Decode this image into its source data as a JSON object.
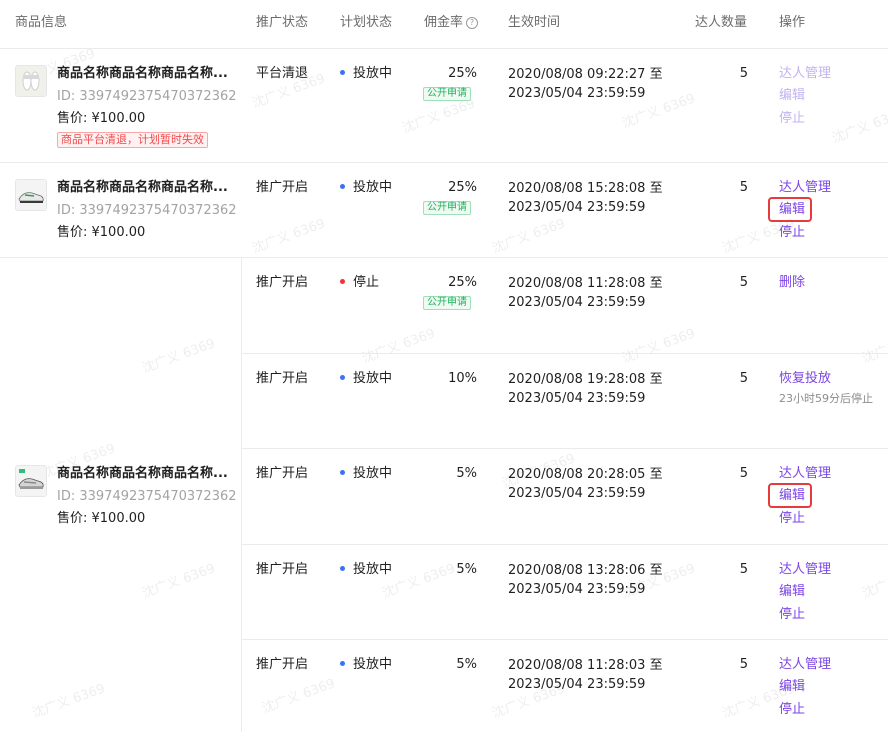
{
  "header": {
    "product_info": "商品信息",
    "promo_status": "推广状态",
    "plan_status": "计划状态",
    "commission_rate": "佣金率",
    "effective_time": "生效时间",
    "creator_count": "达人数量",
    "actions": "操作",
    "help_glyph": "?"
  },
  "products": [
    {
      "name": "商品名称商品名称商品名称...",
      "id": "ID: 3397492375470372362",
      "price": "售价: ¥100.00",
      "warning": "商品平台清退，计划暂时失效"
    },
    {
      "name": "商品名称商品名称商品名称...",
      "id": "ID: 3397492375470372362",
      "price": "售价: ¥100.00"
    },
    {
      "name": "商品名称商品名称商品名称...",
      "id": "ID: 3397492375470372362",
      "price": "售价: ¥100.00"
    }
  ],
  "rows": [
    {
      "promo": "平台清退",
      "plan": "投放中",
      "plan_color": "blue",
      "rate": "25%",
      "tag": "公开申请",
      "time1": "2020/08/08  09:22:27 至",
      "time2": "2023/05/04  23:59:59",
      "count": "5",
      "actions": [
        "达人管理",
        "编辑",
        "停止"
      ],
      "disabled": true
    },
    {
      "promo": "推广开启",
      "plan": "投放中",
      "plan_color": "blue",
      "rate": "25%",
      "tag": "公开申请",
      "time1": "2020/08/08  15:28:08 至",
      "time2": "2023/05/04  23:59:59",
      "count": "5",
      "actions": [
        "达人管理",
        "编辑",
        "停止"
      ]
    },
    {
      "promo": "推广开启",
      "plan": "停止",
      "plan_color": "red",
      "rate": "25%",
      "tag": "公开申请",
      "time1": "2020/08/08  11:28:08 至",
      "time2": "2023/05/04  23:59:59",
      "count": "5",
      "actions": [
        "删除"
      ]
    },
    {
      "promo": "推广开启",
      "plan": "投放中",
      "plan_color": "blue",
      "rate": "10%",
      "time1": "2020/08/08  19:28:08 至",
      "time2": "2023/05/04  23:59:59",
      "count": "5",
      "actions": [
        "恢复投放"
      ],
      "note": "23小时59分后停止"
    },
    {
      "promo": "推广开启",
      "plan": "投放中",
      "plan_color": "blue",
      "rate": "5%",
      "time1": "2020/08/08  20:28:05 至",
      "time2": "2023/05/04  23:59:59",
      "count": "5",
      "actions": [
        "达人管理",
        "编辑",
        "停止"
      ]
    },
    {
      "promo": "推广开启",
      "plan": "投放中",
      "plan_color": "blue",
      "rate": "5%",
      "time1": "2020/08/08  13:28:06 至",
      "time2": "2023/05/04  23:59:59",
      "count": "5",
      "actions": [
        "达人管理",
        "编辑",
        "停止"
      ]
    },
    {
      "promo": "推广开启",
      "plan": "投放中",
      "plan_color": "blue",
      "rate": "5%",
      "time1": "2020/08/08  11:28:03 至",
      "time2": "2023/05/04  23:59:59",
      "count": "5",
      "actions": [
        "达人管理",
        "编辑",
        "停止"
      ]
    }
  ],
  "watermark": "沈广义 6369",
  "colors": {
    "link": "#7b45e6",
    "link_disabled": "#c2b3f0",
    "status_blue": "#3a72f5",
    "status_red": "#f5303a",
    "tag_green": "#22b35e",
    "highlight": "#e63b3b"
  }
}
